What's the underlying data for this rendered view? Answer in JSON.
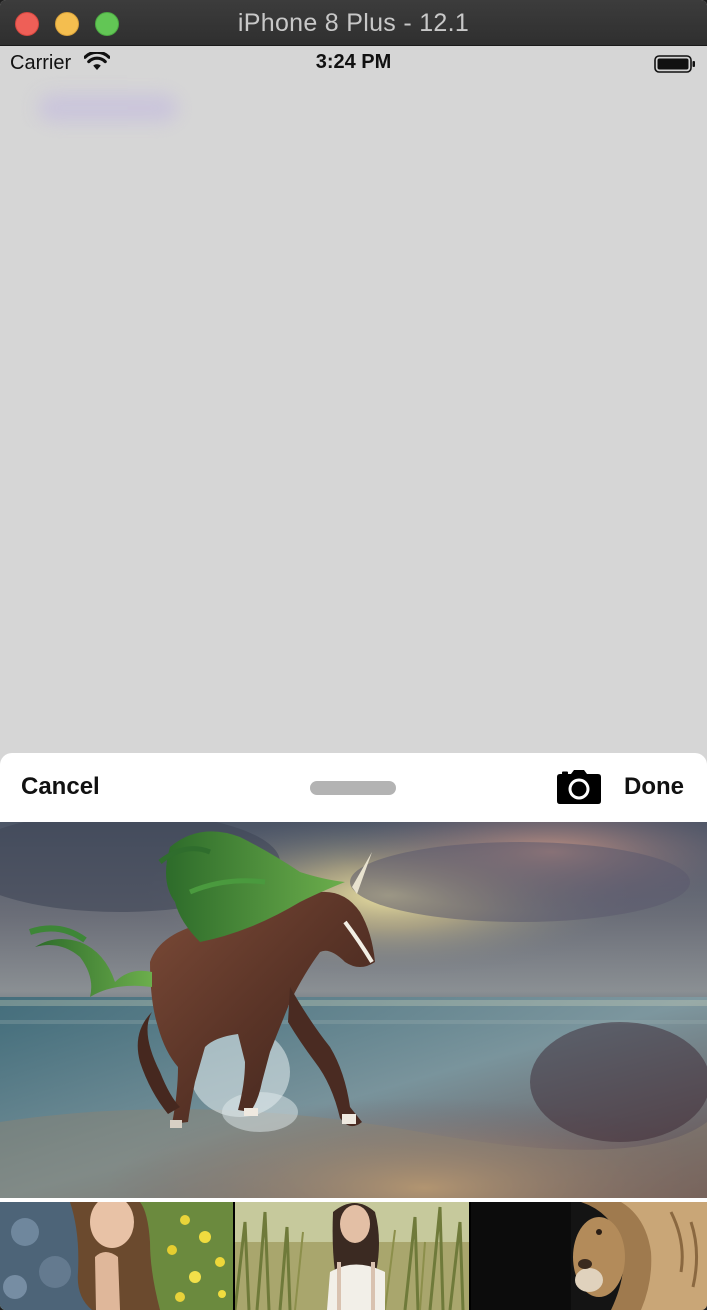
{
  "window": {
    "title": "iPhone 8 Plus - 12.1"
  },
  "status_bar": {
    "carrier": "Carrier",
    "time": "3:24 PM",
    "wifi_icon": "wifi-icon",
    "battery_icon": "battery-icon"
  },
  "picker": {
    "cancel_label": "Cancel",
    "done_label": "Done",
    "camera_icon": "camera-icon",
    "preview_image": "unicorn-running-on-beach-photo",
    "thumbnails": [
      {
        "name": "woman-in-denim-with-flowers-photo"
      },
      {
        "name": "woman-in-tall-grass-photo"
      },
      {
        "name": "lion-portrait-photo"
      }
    ]
  },
  "colors": {
    "background": "#d6d6d6",
    "sheet": "#ffffff",
    "text": "#111111",
    "grabber": "#b3b3b3"
  }
}
